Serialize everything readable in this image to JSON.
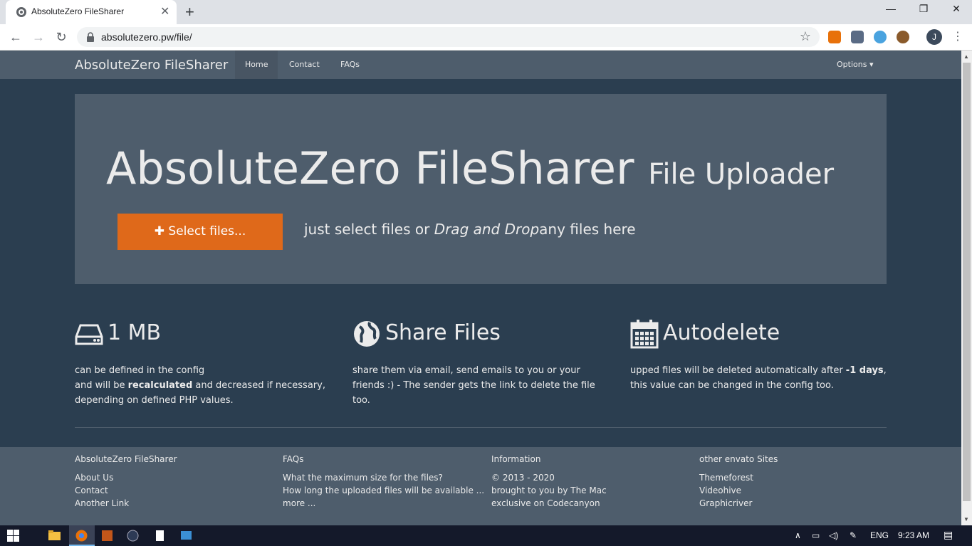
{
  "browser": {
    "tab_title": "AbsoluteZero FileSharer",
    "new_tab": "+",
    "minimize": "—",
    "maximize": "❐",
    "close": "✕",
    "back": "←",
    "forward": "→",
    "reload": "↻",
    "url": "absolutezero.pw/file/",
    "bookmark": "☆",
    "profile_initial": "J",
    "menu": "⋮"
  },
  "navbar": {
    "brand": "AbsoluteZero FileSharer",
    "links": [
      "Home",
      "Contact",
      "FAQs"
    ],
    "options": "Options ▾"
  },
  "jumbotron": {
    "title": "AbsoluteZero FileSharer",
    "subtitle": "File Uploader",
    "button": "Select files...",
    "hint_pre": "just select files or ",
    "hint_em": "Drag and Drop",
    "hint_post": "any files here"
  },
  "features": [
    {
      "icon": "harddrive-icon",
      "title": "1 MB",
      "line1": "can be defined in the config",
      "line2_pre": "and will be ",
      "line2_b": "recalculated",
      "line2_post": " and decreased if necessary, depending on defined PHP values."
    },
    {
      "icon": "globe-icon",
      "title": "Share Files",
      "text": "share them via email, send emails to you or your friends :) - The sender gets the link to delete the file too."
    },
    {
      "icon": "calendar-icon",
      "title": "Autodelete",
      "pre": "upped files will be deleted automatically after ",
      "b": "-1 days",
      "post": ", this value can be changed in the config too."
    }
  ],
  "footer": {
    "cols": [
      {
        "heading": "AbsoluteZero FileSharer",
        "links": [
          "About Us",
          "Contact",
          "Another Link"
        ]
      },
      {
        "heading": "FAQs",
        "links": [
          "What the maximum size for the files?",
          "How long the uploaded files will be available ...",
          "more ..."
        ]
      },
      {
        "heading": "Information",
        "links": [
          "© 2013 - 2020",
          "brought to you by The Mac",
          "exclusive on Codecanyon"
        ]
      },
      {
        "heading": "other envato Sites",
        "links": [
          "Themeforest",
          "Videohive",
          "Graphicriver"
        ]
      }
    ]
  },
  "taskbar": {
    "lang": "ENG",
    "time": "9:23 AM"
  },
  "colors": {
    "page_bg": "#2b3e50",
    "panel": "#4e5d6c",
    "accent": "#df691a"
  }
}
